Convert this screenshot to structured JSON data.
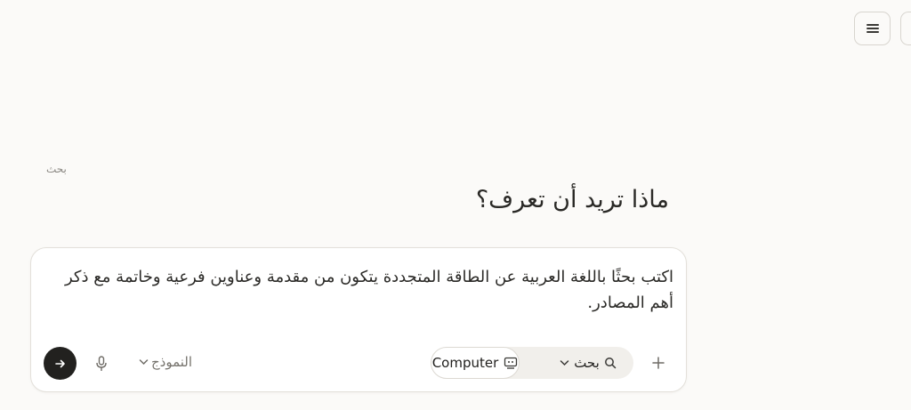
{
  "header": {
    "menu_icon": "hamburger-icon"
  },
  "mode_hint": "بحث",
  "heading": "ماذا تريد أن تعرف؟",
  "composer": {
    "prompt_text": "اكتب بحثًا باللغة العربية عن الطاقة المتجددة يتكون من مقدمة وعناوين فرعية وخاتمة مع ذكر أهم المصادر.",
    "model_label": "النموذج",
    "search_label": "بحث",
    "computer_label": "Computer",
    "send_icon": "arrow-right-icon",
    "mic_icon": "microphone-icon",
    "add_icon": "plus-icon",
    "search_icon": "magnifier-icon",
    "computer_icon": "robot-monitor-icon"
  }
}
